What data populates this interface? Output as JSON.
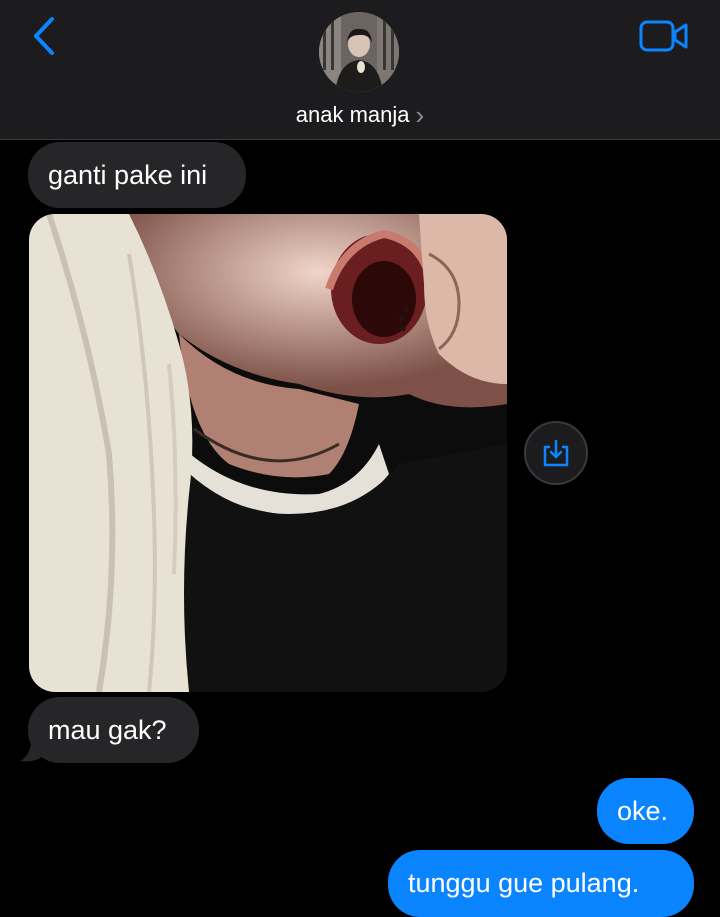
{
  "header": {
    "contact_name": "anak manja",
    "chevron": "›",
    "back_icon": "chevron-left-icon",
    "video_icon": "video-camera-icon",
    "accent": "#0a84ff"
  },
  "messages": {
    "incoming_1": "ganti pake ini",
    "incoming_2": "mau gak?",
    "outgoing_1": "oke.",
    "outgoing_2": "tunggu gue pulang."
  },
  "colors": {
    "incoming_bubble": "#262628",
    "outgoing_bubble": "#0a84ff",
    "background": "#000000",
    "header": "#1c1c1e"
  }
}
